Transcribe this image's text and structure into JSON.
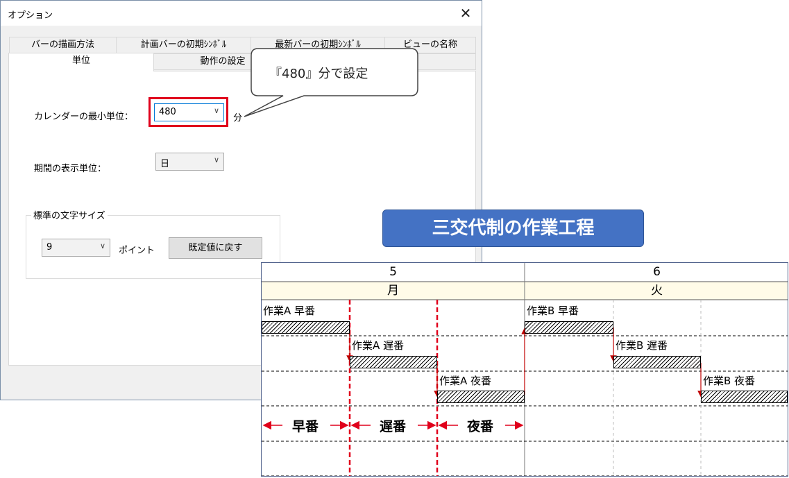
{
  "dialog": {
    "title": "オプション",
    "close_glyph": "✕",
    "tabs_row1": [
      "バーの描画方法",
      "計画バーの初期ｼﾝﾎﾞﾙ",
      "最新バーの初期ｼﾝﾎﾞﾙ",
      "ビューの名称"
    ],
    "tabs_row2": [
      "単位",
      "動作の設定",
      ""
    ],
    "calendar_unit_label": "カレンダーの最小単位：",
    "calendar_unit_value": "480",
    "calendar_unit_suffix": "分",
    "period_unit_label": "期間の表示単位：",
    "period_unit_value": "日",
    "font_group_title": "標準の文字サイズ",
    "font_size_value": "9",
    "font_size_unit": "ポイント",
    "reset_button": "既定値に戻す",
    "dropdown_glyph": "∨"
  },
  "callout": {
    "text": "『480』分で設定"
  },
  "gantt": {
    "title": "三交代制の作業工程",
    "days": [
      {
        "date": "5",
        "weekday": "月"
      },
      {
        "date": "6",
        "weekday": "火"
      }
    ],
    "tasks": [
      "作業A 早番",
      "作業A 遅番",
      "作業A 夜番",
      "作業B 早番",
      "作業B 遅番",
      "作業B 夜番"
    ],
    "shifts": [
      "早番",
      "遅番",
      "夜番"
    ],
    "colors": {
      "header_bg": "#fffbe8",
      "arrow": "#c00000",
      "shift_line": "#e0001b"
    }
  }
}
